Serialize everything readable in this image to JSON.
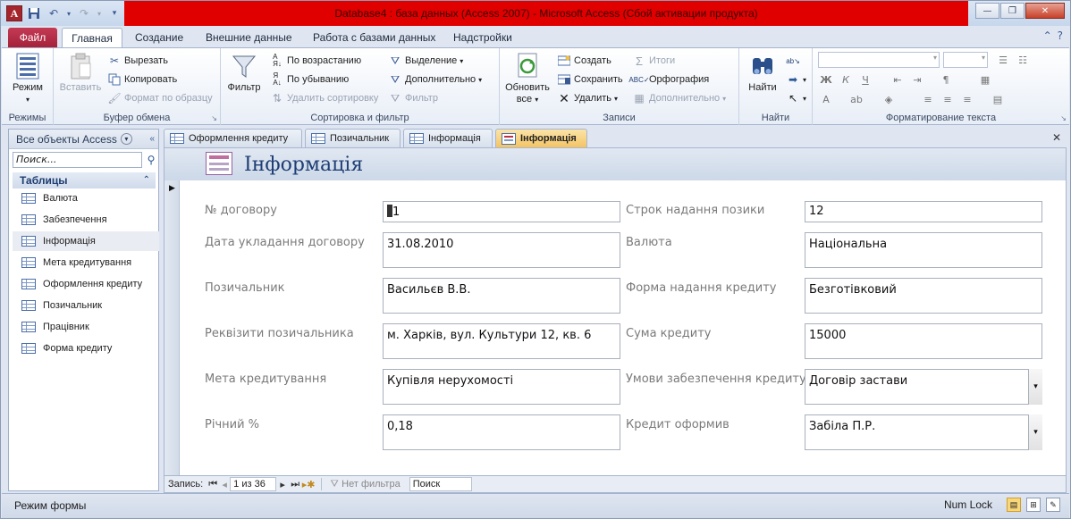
{
  "window": {
    "title": "Database4 : база данных (Access 2007)  -  Microsoft Access (Сбой активации продукта)",
    "app_icon_letter": "A",
    "minimize_icon": "—",
    "restore_icon": "❐",
    "close_icon": "✕"
  },
  "ribbon_tabs": {
    "file": "Файл",
    "home": "Главная",
    "create": "Создание",
    "external": "Внешние данные",
    "db_tools": "Работа с базами данных",
    "addins": "Надстройки"
  },
  "ribbon": {
    "views": {
      "label": "Режимы",
      "view_btn": "Режим"
    },
    "clipboard": {
      "label": "Буфер обмена",
      "paste": "Вставить",
      "cut": "Вырезать",
      "copy": "Копировать",
      "format_painter": "Формат по образцу"
    },
    "sort_filter": {
      "label": "Сортировка и фильтр",
      "filter": "Фильтр",
      "ascending": "По возрастанию",
      "descending": "По убыванию",
      "remove_sort": "Удалить сортировку",
      "selection": "Выделение",
      "advanced": "Дополнительно",
      "toggle_filter": "Фильтр"
    },
    "records": {
      "label": "Записи",
      "refresh_all_1": "Обновить",
      "refresh_all_2": "все",
      "new": "Создать",
      "save": "Сохранить",
      "delete": "Удалить",
      "totals": "Итоги",
      "spelling": "Орфография",
      "more": "Дополнительно"
    },
    "find": {
      "label": "Найти",
      "find": "Найти"
    },
    "text_format": {
      "label": "Форматирование текста"
    }
  },
  "nav_pane": {
    "header": "Все объекты Access",
    "search_placeholder": "Поиск...",
    "section": "Таблицы",
    "items": [
      "Валюта",
      "Забезпечення",
      "Інформація",
      "Мета кредитування",
      "Оформлення кредиту",
      "Позичальник",
      "Працівник",
      "Форма кредиту"
    ],
    "selected_item": "Інформація"
  },
  "doc_tabs": [
    "Оформлення кредиту",
    "Позичальник",
    "Інформація",
    "Інформація"
  ],
  "form": {
    "title": "Інформація",
    "fields": {
      "contract_no": {
        "label": "№ договору",
        "value": "1"
      },
      "contract_date": {
        "label": "Дата укладання договору",
        "value": "31.08.2010"
      },
      "borrower": {
        "label": "Позичальник",
        "value": "Васильєв В.В."
      },
      "borrower_details": {
        "label": "Реквізити позичальника",
        "value": "м. Харків, вул. Культури 12, кв. 6"
      },
      "purpose": {
        "label": "Мета кредитування",
        "value": "Купівля нерухомості"
      },
      "annual_rate": {
        "label": "Річний %",
        "value": "0,18"
      },
      "loan_term": {
        "label": "Строк надання позики",
        "value": "12"
      },
      "currency": {
        "label": "Валюта",
        "value": "Національна"
      },
      "loan_form": {
        "label": "Форма надання кредиту",
        "value": "Безготівковий"
      },
      "loan_amount": {
        "label": "Сума кредиту",
        "value": "15000"
      },
      "collateral": {
        "label": "Умови забезпечення кредиту",
        "value": "Договір застави"
      },
      "issued_by": {
        "label": "Кредит оформив",
        "value": "Забіла П.Р."
      }
    }
  },
  "record_nav": {
    "label": "Запись:",
    "position": "1 из 36",
    "filter_status": "Нет фильтра",
    "search": "Поиск"
  },
  "status_bar": {
    "mode": "Режим формы",
    "num_lock": "Num Lock"
  },
  "colors": {
    "title_bar_red": "#e00000",
    "file_tab": "#b12c46",
    "active_doc_tab": "#f4c464",
    "form_title": "#1f3e74"
  }
}
